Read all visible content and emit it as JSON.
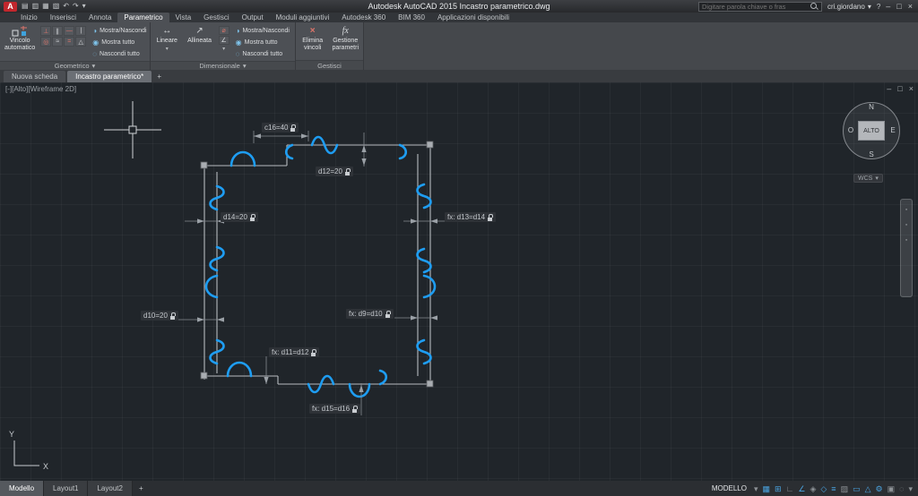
{
  "titlebar": {
    "logo": "A",
    "title": "Autodesk AutoCAD 2015   Incastro parametrico.dwg",
    "search_placeholder": "Digitare parola chiave o fras",
    "user": "cri.giordano"
  },
  "ribbon_tabs": [
    "Inizio",
    "Inserisci",
    "Annota",
    "Parametrico",
    "Vista",
    "Gestisci",
    "Output",
    "Moduli aggiuntivi",
    "Autodesk 360",
    "BIM 360",
    "Applicazioni disponibili"
  ],
  "panels": {
    "geometrico": {
      "title": "Geometrico",
      "auto": "Vincolo automatico",
      "show_hide": "Mostra/Nascondi",
      "show_all": "Mostra tutto",
      "hide_all": "Nascondi tutto"
    },
    "dimensionale": {
      "title": "Dimensionale",
      "linear": "Lineare",
      "aligned": "Allineata",
      "show_hide": "Mostra/Nascondi",
      "show_all": "Mostra tutto",
      "hide_all": "Nascondi tutto"
    },
    "gestisci": {
      "title": "Gestisci",
      "delete": "Elimina vincoli",
      "manager": "Gestione parametri"
    }
  },
  "doc_tabs": {
    "new_tab": "Nuova scheda",
    "active_tab": "Incastro parametrico*"
  },
  "viewport": {
    "label": "[-][Alto][Wireframe 2D]"
  },
  "viewcube": {
    "n": "N",
    "e": "E",
    "s": "S",
    "w": "O",
    "center": "ALTO",
    "wcs": "WCS"
  },
  "drawing": {
    "dims": [
      {
        "text": "c16=40"
      },
      {
        "text": "d12=20"
      },
      {
        "text": "d14=20"
      },
      {
        "text": "fx: d13=d14"
      },
      {
        "text": "d10=20"
      },
      {
        "text": "fx: d9=d10"
      },
      {
        "text": "fx: d11=d12"
      },
      {
        "text": "fx: d15=d16"
      }
    ],
    "ucs_x": "X",
    "ucs_y": "Y"
  },
  "layout_tabs": {
    "model": "Modello",
    "l1": "Layout1",
    "l2": "Layout2"
  },
  "status": {
    "model": "MODELLO"
  },
  "icons": {
    "dropdown": "▾",
    "plus": "+",
    "minimize": "–",
    "maximize": "□",
    "close": "×",
    "new": "▤",
    "open": "▥",
    "save": "▦",
    "plot": "▧",
    "undo": "↶",
    "redo": "↷",
    "help": "?",
    "grid": "▦",
    "snap": "⊞",
    "ortho": "∟",
    "polar": "∠",
    "osnap": "◇",
    "dyn": "▭",
    "lwt": "≡",
    "transp": "▨",
    "iso": "◈",
    "sel": "△",
    "gear": "⚙",
    "monitor": "▣",
    "clean": "◌",
    "eye_half": "◑",
    "eye_on": "◉",
    "eye_off": "◌",
    "linear_dim": "↔",
    "aligned_dim": "↗",
    "diameter": "⌀",
    "angular": "∠",
    "fx": "fx",
    "delete_x": "×",
    "perp": "⊥",
    "para": "∥",
    "horiz": "—",
    "vert": "|",
    "conc": "◎",
    "smooth": "≈",
    "equal": "=",
    "symm": "△",
    "navdot": "◦"
  }
}
